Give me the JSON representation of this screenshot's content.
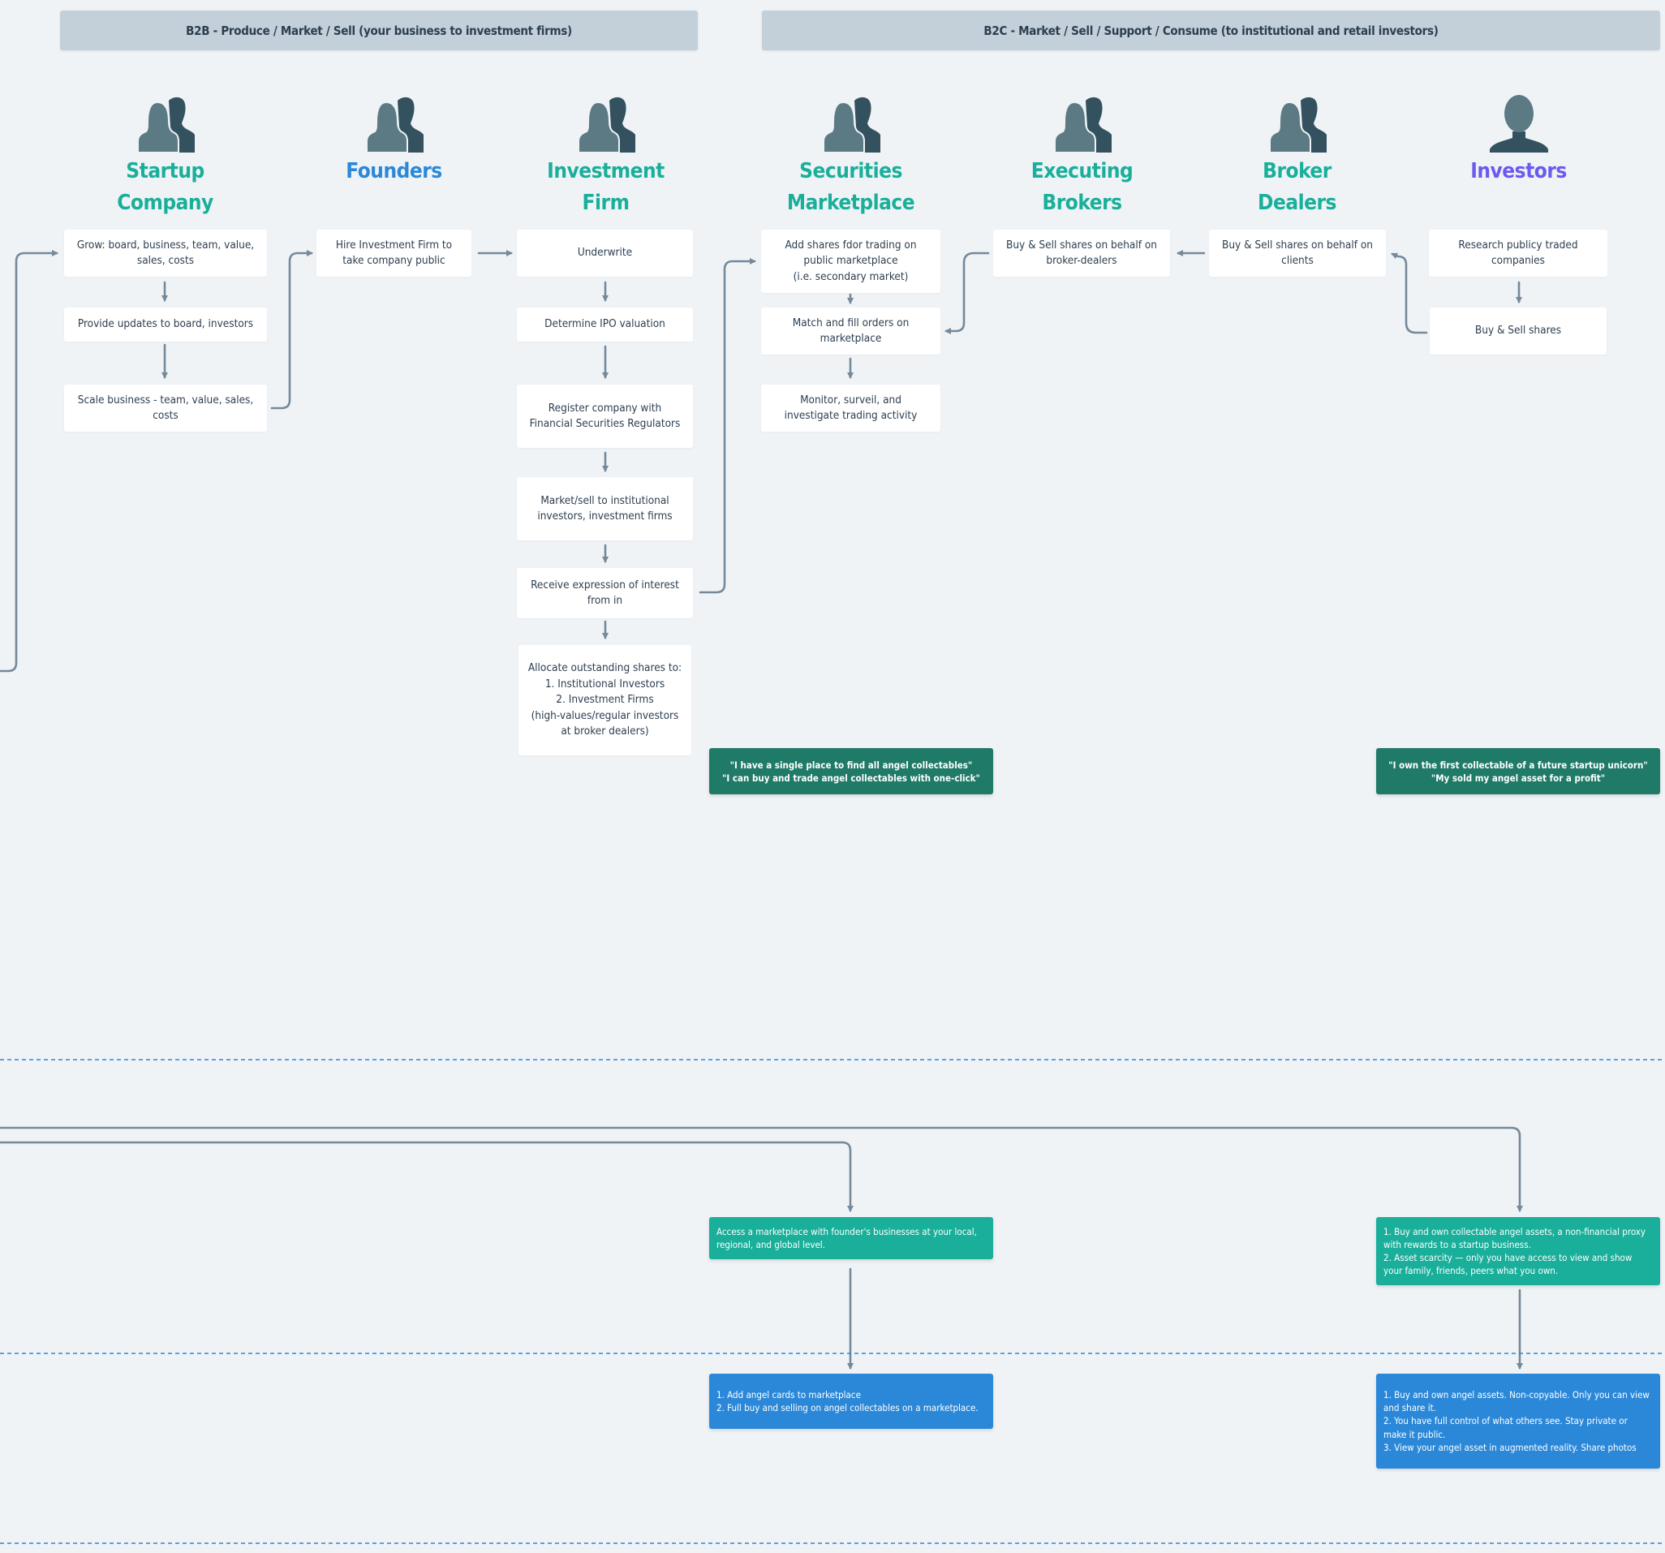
{
  "bands": {
    "b2b": "B2B - Produce / Market / Sell (your business to investment firms)",
    "b2c": "B2C - Market / Sell / Support / Consume (to institutional and retail investors)"
  },
  "colors": {
    "background": "#eff3f6",
    "band": "#c3cfd9",
    "teal_title": "#1aaf9a",
    "blue_title": "#2b88d8",
    "purple_title": "#6a5af0",
    "connector": "#74899a",
    "quote_bg": "#207a68",
    "note_teal": "#1aaf9a",
    "note_blue": "#2b88d8",
    "divider": "#2b88d8"
  },
  "lanes": [
    {
      "title": "Startup\nCompany",
      "icon": "users-icon",
      "color": "teal"
    },
    {
      "title": "Founders",
      "icon": "users-icon",
      "color": "blue"
    },
    {
      "title": "Investment\nFirm",
      "icon": "users-icon",
      "color": "teal"
    },
    {
      "title": "Securities\nMarketplace",
      "icon": "users-icon",
      "color": "teal"
    },
    {
      "title": "Executing\nBrokers",
      "icon": "users-icon",
      "color": "teal"
    },
    {
      "title": "Broker\nDealers",
      "icon": "users-icon",
      "color": "teal"
    },
    {
      "title": "Investors",
      "icon": "user-icon",
      "color": "purple"
    }
  ],
  "steps": {
    "startup": [
      "Grow: board, business, team, value,\nsales, costs",
      "Provide updates to board, investors",
      "Scale business - team, value, sales,\ncosts"
    ],
    "founders": [
      "Hire Investment Firm to\ntake company public"
    ],
    "investment_firm": [
      "Underwrite",
      "Determine IPO valuation",
      "Register company with\nFinancial Securities Regulators",
      "Market/sell to institutional\ninvestors, investment firms",
      "Receive expression of interest\nfrom in",
      "Allocate outstanding shares to:\n1. Institutional Investors\n2. Investment Firms\n(high-values/regular investors\nat broker dealers)"
    ],
    "marketplace": [
      "Add shares fdor trading on\npublic marketplace\n(i.e. secondary market)",
      "Match and fill orders on\nmarketplace",
      "Monitor, surveil, and\ninvestigate trading activity"
    ],
    "executing_brokers": [
      "Buy & Sell shares on behalf on\nbroker-dealers"
    ],
    "broker_dealers": [
      "Buy & Sell shares on behalf on\nclients"
    ],
    "investors": [
      "Research publicy traded\ncompanies",
      "Buy & Sell shares"
    ]
  },
  "quotes": {
    "marketplace": "\"I have a single place to find all angel collectables\"\n\"I can buy and trade angel collectables with one-click\"",
    "investors": "\"I own the first collectable of a future startup unicorn\"\n\"My sold my angel asset for a profit\""
  },
  "notes": {
    "marketplace_teal": "Access a marketplace with founder's businesses at your local,\nregional, and global level.",
    "investors_teal": "1. Buy and own collectable angel assets, a non-financial proxy\nwith rewards to a startup business.\n2. Asset scarcity — only you have access to view and show\nyour family, friends, peers what you own.",
    "marketplace_blue": "1. Add angel cards to marketplace\n2. Full buy and selling on angel collectables on a marketplace.",
    "investors_blue": "1. Buy and own angel assets. Non-copyable. Only you can view\nand share it.\n2. You have full control of what others see. Stay private or\nmake it public.\n3. View your angel asset in augmented reality. Share photos"
  }
}
